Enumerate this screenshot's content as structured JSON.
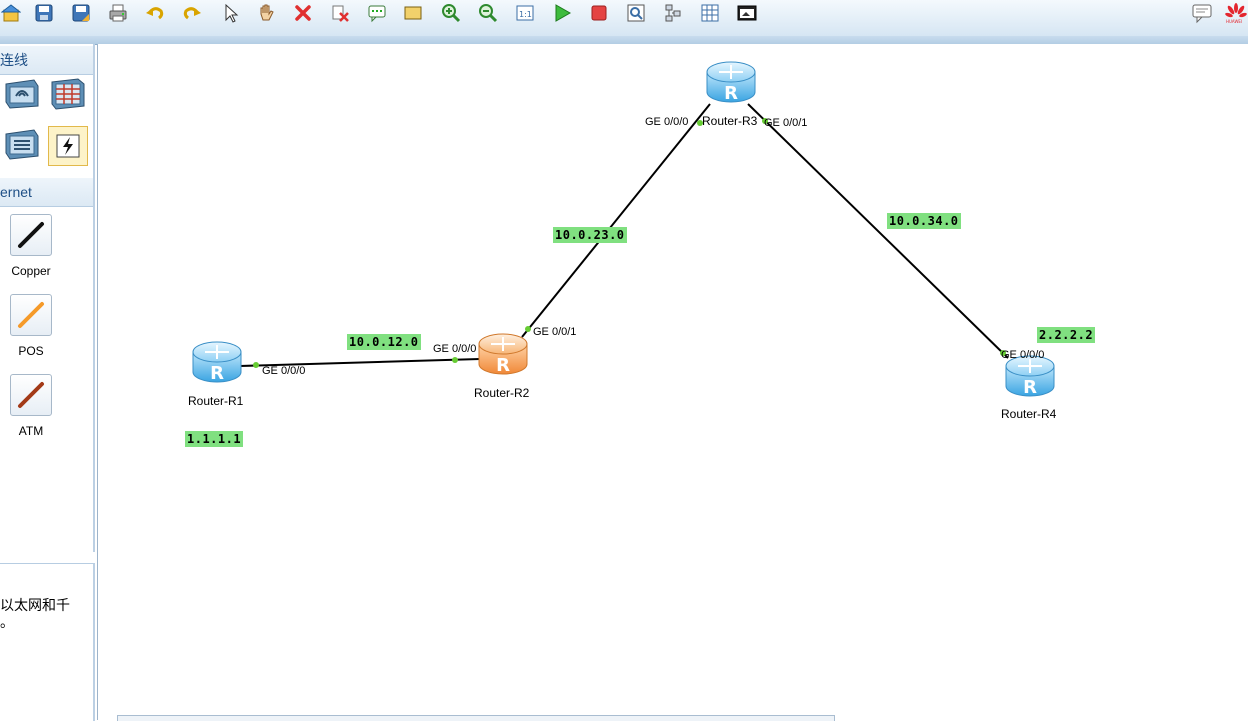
{
  "toolbar": {
    "icons": [
      "home-icon",
      "save-icon",
      "save-as-icon",
      "print-icon",
      "undo-icon",
      "redo-icon",
      "pointer-icon",
      "hand-icon",
      "delete-icon",
      "clear-icon",
      "text-icon",
      "rectangle-icon",
      "zoom-in-icon",
      "zoom-out-icon",
      "fit-icon",
      "start-icon",
      "stop-icon",
      "capture-icon",
      "topology-icon",
      "grid-icon",
      "terminal-icon"
    ],
    "right_icons": [
      "chat-icon",
      "huawei-logo-icon"
    ]
  },
  "left_panel": {
    "connection_section": "连线",
    "ethernet_section": "ernet",
    "cables": [
      "Copper",
      "POS",
      "ATM"
    ]
  },
  "description": {
    "line1": "以太网和千",
    "line2": "。"
  },
  "topology": {
    "routers": [
      {
        "name": "Router-R1",
        "color": "blue"
      },
      {
        "name": "Router-R2",
        "color": "orange"
      },
      {
        "name": "Router-R3",
        "color": "blue"
      },
      {
        "name": "Router-R4",
        "color": "blue"
      }
    ],
    "ports": {
      "r1_ge000": "GE 0/0/0",
      "r2_ge000": "GE 0/0/0",
      "r2_ge001": "GE 0/0/1",
      "r3_ge000": "GE 0/0/0",
      "r3_ge001": "GE 0/0/1",
      "r4_ge000": "GE 0/0/0"
    },
    "labels": {
      "net_12": "10.0.12.0",
      "net_23": "10.0.23.0",
      "net_34": "10.0.34.0",
      "r1_loopback": "1.1.1.1",
      "r4_loopback": "2.2.2.2"
    },
    "colors": {
      "router_blue": "#5ab8ec",
      "router_orange": "#f4a15c",
      "label_bg": "#80e080",
      "port_dot": "#66cc33"
    }
  }
}
